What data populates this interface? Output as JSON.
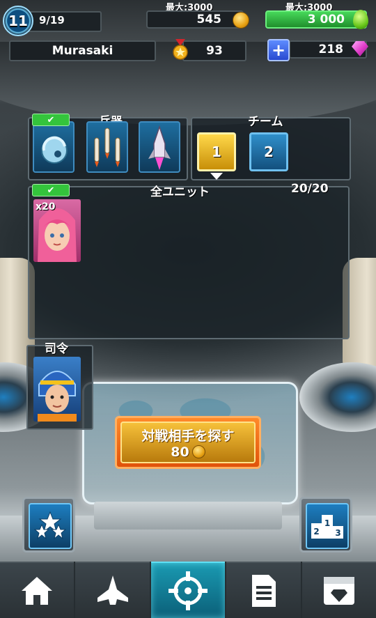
{
  "header": {
    "level": "11",
    "xp": "9/19",
    "coins_cap": "最大:3000",
    "coins": "545",
    "energy_cap": "最大:3000",
    "energy": "3 000",
    "player_name": "Murasaki",
    "trophies": "93",
    "gems": "218"
  },
  "weapons": {
    "label": "兵器",
    "slots": [
      "shield-drone-icon",
      "missile-cluster-icon",
      "rocket-ship-icon"
    ],
    "equipped_check": "✔"
  },
  "team": {
    "label": "チーム",
    "buttons": [
      "1",
      "2"
    ],
    "active": "1"
  },
  "units": {
    "label": "全ユニット",
    "count": "20/20",
    "cards": [
      {
        "multiplier": "x20",
        "portrait": "pink-hair-pilot-portrait"
      }
    ]
  },
  "commander": {
    "label": "司令",
    "portrait": "blue-helmet-commander-portrait"
  },
  "find_opponent": {
    "label": "対戦相手を探す",
    "cost": "80"
  },
  "side_buttons": {
    "left_icon": "stars-icon",
    "right_icon": "leaderboard-podium-icon"
  },
  "nav": {
    "tabs": [
      "home-icon",
      "ship-icon",
      "crosshair-icon",
      "document-icon",
      "store-gem-icon"
    ],
    "active_index": 2
  },
  "colors": {
    "energy_green": "#2fb845",
    "coin_gold": "#e8a112",
    "active_team": "#f3c12b",
    "nav_active": "#1a9ab2",
    "find_button_orange": "#f07020"
  }
}
